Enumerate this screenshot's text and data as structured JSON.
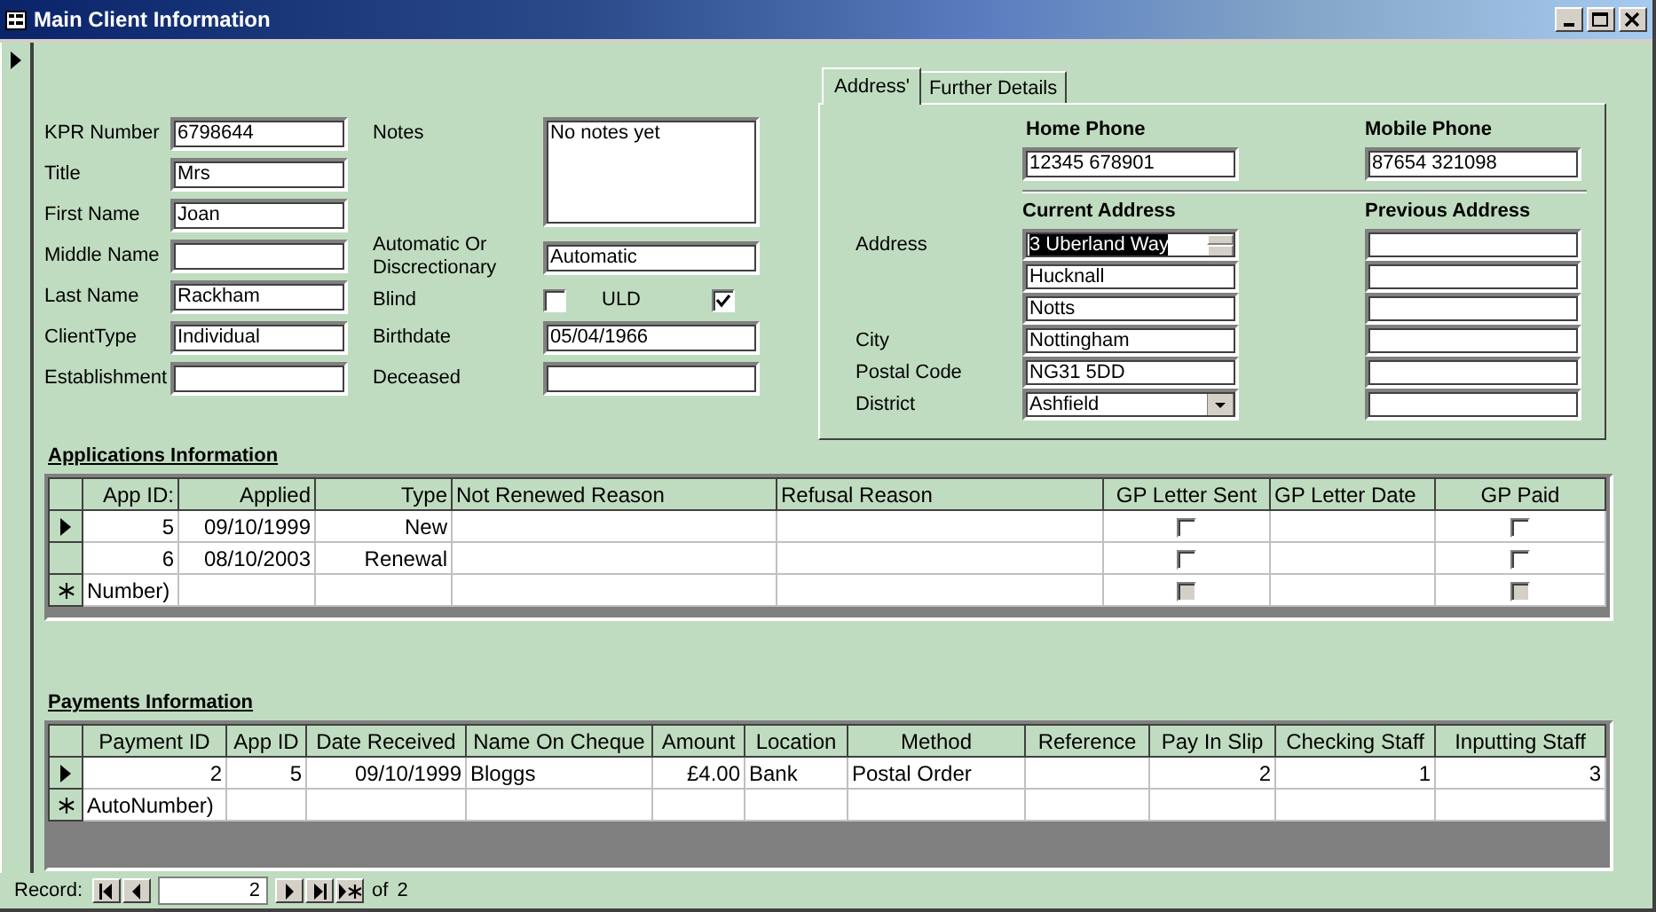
{
  "window": {
    "title": "Main Client Information"
  },
  "client_fields": [
    {
      "label": "KPR Number",
      "value": "6798644"
    },
    {
      "label": "Title",
      "value": "Mrs"
    },
    {
      "label": "First Name",
      "value": "Joan"
    },
    {
      "label": "Middle Name"
    },
    {
      "label": "Last Name",
      "value": "Rackham"
    },
    {
      "label": "ClientType",
      "value": "Individual"
    },
    {
      "label": "Establishment"
    }
  ],
  "notes": {
    "label": "Notes",
    "value": "No notes yet"
  },
  "funding": {
    "label": "Automatic Or Discrectionary",
    "value": "Automatic"
  },
  "blind": {
    "label": "Blind",
    "checked": false
  },
  "uld": {
    "label": "ULD",
    "checked": true
  },
  "birthdate": {
    "label": "Birthdate",
    "value": "05/04/1966"
  },
  "deceased": {
    "label": "Deceased"
  },
  "tabs": [
    {
      "label": "Address'",
      "selected": true
    },
    {
      "label": "Further Details",
      "selected": false
    }
  ],
  "phones": [
    {
      "label": "Home Phone",
      "value": "12345 678901"
    },
    {
      "label": "Mobile Phone",
      "value": "87654 321098"
    }
  ],
  "address_headings": [
    "Current Address",
    "Previous Address"
  ],
  "address_rows": [
    {
      "label": "Address",
      "kind": "spin",
      "current": "3 Uberland Way",
      "text_selected": true,
      "previous": ""
    },
    {
      "label": "",
      "kind": "text",
      "current": "Hucknall",
      "text_selected": false,
      "previous": ""
    },
    {
      "label": "",
      "kind": "text",
      "current": "Notts",
      "text_selected": false,
      "previous": ""
    },
    {
      "label": "City",
      "kind": "text",
      "current": "Nottingham",
      "text_selected": false,
      "previous": ""
    },
    {
      "label": "Postal Code",
      "kind": "text",
      "current": "NG31 5DD",
      "text_selected": false,
      "previous": ""
    },
    {
      "label": "District",
      "kind": "dropdown",
      "current": "Ashfield",
      "text_selected": false,
      "previous": ""
    }
  ],
  "applications": {
    "title": "Applications Information",
    "columns": [
      "App ID:",
      "Applied",
      "Type",
      "Not Renewed Reason",
      "Refusal Reason",
      "GP Letter Sent",
      "GP Letter Date",
      "GP Paid"
    ],
    "rows": [
      {
        "kind": "record",
        "selected": true,
        "cells": [
          "5",
          "09/10/1999",
          "New",
          "",
          "",
          {
            "checked": false,
            "disabled": false
          },
          "",
          {
            "checked": false,
            "disabled": false
          }
        ]
      },
      {
        "kind": "record",
        "selected": false,
        "cells": [
          "6",
          "08/10/2003",
          "Renewal",
          "",
          "",
          {
            "checked": false,
            "disabled": false
          },
          "",
          {
            "checked": false,
            "disabled": false
          }
        ]
      },
      {
        "kind": "new",
        "selected": false,
        "cells": [
          "Number)",
          "",
          "",
          "",
          "",
          {
            "checked": false,
            "disabled": true
          },
          "",
          {
            "checked": false,
            "disabled": true
          }
        ]
      }
    ]
  },
  "payments": {
    "title": "Payments Information",
    "columns": [
      "Payment ID",
      "App ID",
      "Date Received",
      "Name On Cheque",
      "Amount",
      "Location",
      "Method",
      "Reference",
      "Pay In Slip",
      "Checking Staff",
      "Inputting Staff"
    ],
    "rows": [
      {
        "kind": "record",
        "selected": true,
        "cells": [
          "2",
          "5",
          "09/10/1999",
          "Bloggs",
          "£4.00",
          "Bank",
          "Postal Order",
          "",
          "2",
          "1",
          "3"
        ]
      },
      {
        "kind": "new",
        "selected": false,
        "cells": [
          "AutoNumber)",
          "",
          "",
          "",
          "",
          "",
          "",
          "",
          "",
          "",
          ""
        ]
      }
    ]
  },
  "navigation": {
    "label": "Record:",
    "current": "2",
    "total_label": "of",
    "total": "2"
  }
}
